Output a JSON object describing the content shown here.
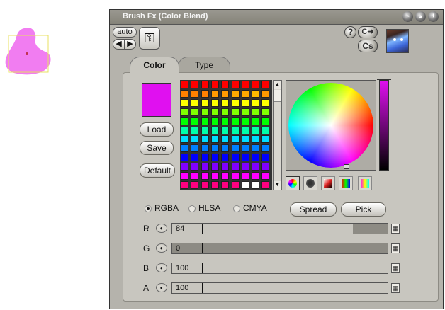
{
  "window": {
    "title": "Brush Fx (Color Blend)"
  },
  "titlebar_buttons": [
    {
      "icon": "minimize-icon",
      "glyph": "◔"
    },
    {
      "icon": "globe-icon",
      "glyph": "◕"
    },
    {
      "icon": "info-icon",
      "glyph": "!"
    }
  ],
  "toolbar": {
    "auto_label": "auto",
    "nav_left": "◀",
    "nav_right": "▶",
    "key_glyph": "⚿",
    "help_glyph": "?",
    "arrow_glyph": "C➜",
    "cs_glyph": "Cs"
  },
  "tabs": [
    {
      "label": "Color",
      "active": true
    },
    {
      "label": "Type",
      "active": false
    }
  ],
  "color": {
    "current_swatch": "#e010f0",
    "load_label": "Load",
    "save_label": "Save",
    "default_label": "Default",
    "palette_rows": [
      [
        "#ff0000",
        "#ff0000",
        "#ff0000",
        "#ff0000",
        "#ff0000",
        "#ff0000",
        "#ff0000",
        "#ff0000",
        "#ff0000"
      ],
      [
        "#ff8000",
        "#ff8000",
        "#ff8000",
        "#ff9900",
        "#ff9900",
        "#ffaa00",
        "#ffaa00",
        "#ffbb00",
        "#ff9900"
      ],
      [
        "#ffff00",
        "#ffff00",
        "#ffff00",
        "#ffff00",
        "#ffff00",
        "#ffff00",
        "#ffff00",
        "#ffff00",
        "#ffff00"
      ],
      [
        "#80ff00",
        "#80ff00",
        "#80ff00",
        "#80ff00",
        "#80ff00",
        "#80ff00",
        "#80ff00",
        "#80ff00",
        "#80ff00"
      ],
      [
        "#00ff00",
        "#00ff00",
        "#00ff00",
        "#00ff00",
        "#00ff00",
        "#00ff00",
        "#00ff00",
        "#00ff00",
        "#00ff00"
      ],
      [
        "#00ffaa",
        "#00ffaa",
        "#00ffaa",
        "#00ffaa",
        "#00ffaa",
        "#00ffaa",
        "#00ffaa",
        "#00ffaa",
        "#00ffaa"
      ],
      [
        "#00ddff",
        "#00ddff",
        "#00ddff",
        "#00ddff",
        "#00ddff",
        "#00ddff",
        "#00ddff",
        "#00ddff",
        "#00ddff"
      ],
      [
        "#0080ff",
        "#0080ff",
        "#0080ff",
        "#0080ff",
        "#0080ff",
        "#0080ff",
        "#0080ff",
        "#0080ff",
        "#0080ff"
      ],
      [
        "#0000ff",
        "#0000ff",
        "#0000ff",
        "#0000ff",
        "#0000ff",
        "#0000ff",
        "#0000ff",
        "#0000ff",
        "#0000ff"
      ],
      [
        "#8000ff",
        "#8000ff",
        "#8000ff",
        "#8000ff",
        "#8000ff",
        "#8000ff",
        "#8000ff",
        "#8000ff",
        "#8000ff"
      ],
      [
        "#ff00ff",
        "#ff00ff",
        "#ff00ff",
        "#ff00ff",
        "#ff00ff",
        "#ff00ff",
        "#ff00ff",
        "#ff00ff",
        "#ff00ff"
      ],
      [
        "#ff0080",
        "#ff0080",
        "#ff0080",
        "#ff0080",
        "#ff0080",
        "#ff0080",
        "#ffffff",
        "#ffffff",
        "#ff0080"
      ]
    ],
    "value_bar_top": "#e010f0",
    "modes": [
      "RGBA",
      "HLSA",
      "CMYA"
    ],
    "selected_mode": "RGBA",
    "spread_label": "Spread",
    "pick_label": "Pick"
  },
  "channels": [
    {
      "label": "R",
      "value": "84",
      "fraction": 0.84
    },
    {
      "label": "G",
      "value": "0",
      "fraction": 0
    },
    {
      "label": "B",
      "value": "100",
      "fraction": 1
    },
    {
      "label": "A",
      "value": "100",
      "fraction": 1
    }
  ],
  "colors": {
    "panel": "#b5b3ac",
    "content": "#c8c6bf",
    "brush": "#ee66ee"
  }
}
